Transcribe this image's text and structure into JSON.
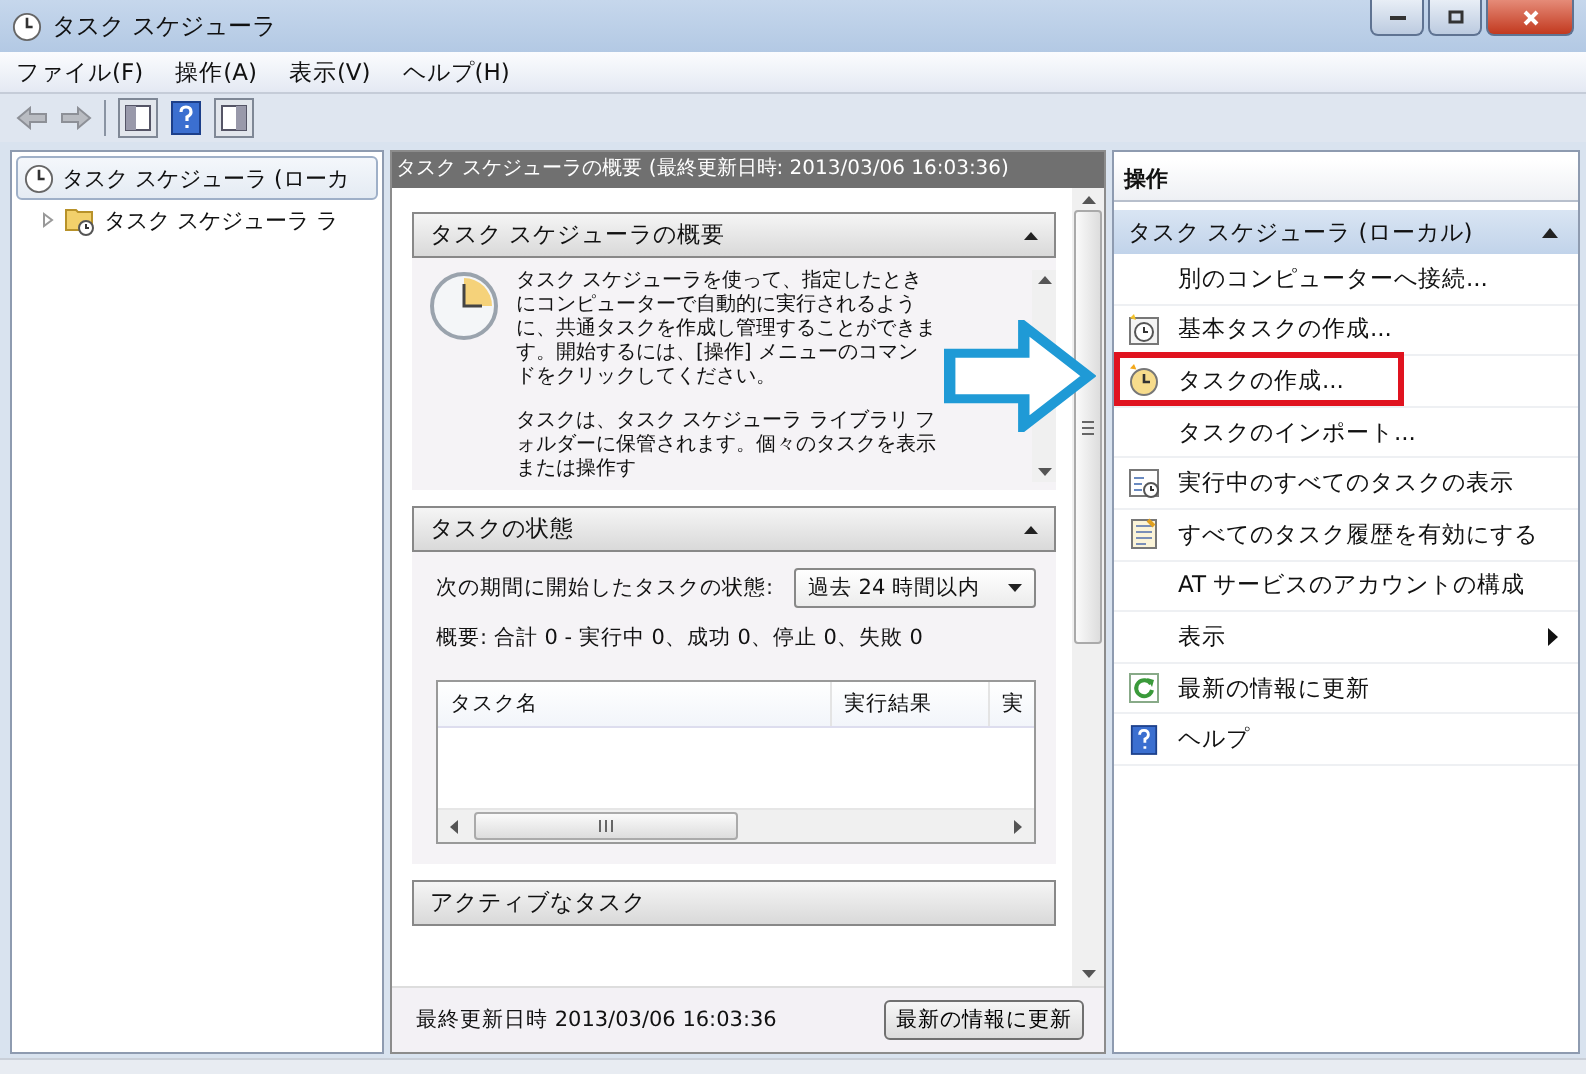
{
  "window": {
    "title": "タスク スケジューラ"
  },
  "menu": [
    "ファイル(F)",
    "操作(A)",
    "表示(V)",
    "ヘルプ(H)"
  ],
  "tree": [
    {
      "label": "タスク スケジューラ (ローカ",
      "selected": true,
      "children": [
        {
          "label": "タスク スケジューラ ラ",
          "selected": false,
          "expanded": false
        }
      ]
    }
  ],
  "center": {
    "title": "タスク スケジューラの概要 (最終更新日時: 2013/03/06 16:03:36)",
    "overview": {
      "title": "タスク スケジューラの概要",
      "paragraphs": [
        "タスク スケジューラを使って、指定したときにコンピューターで自動的に実行されるように、共通タスクを作成し管理することができます。開始するには、[操作] メニューのコマンドをクリックしてください。",
        "タスクは、タスク スケジューラ ライブラリ フォルダーに保管されます。個々のタスクを表示または操作す"
      ]
    },
    "status": {
      "title": "タスクの状態",
      "filter_label": "次の期間に開始したタスクの状態:",
      "filter_value": "過去 24 時間以内",
      "summary": "概要: 合計 0 - 実行中 0、成功 0、停止 0、失敗 0",
      "columns": [
        "タスク名",
        "実行結果",
        "実"
      ]
    },
    "active": {
      "title": "アクティブなタスク"
    },
    "footer": {
      "updated": "最終更新日時 2013/03/06 16:03:36",
      "refresh_button": "最新の情報に更新"
    }
  },
  "actions": {
    "title": "操作",
    "group": "タスク スケジューラ (ローカル)",
    "items": [
      {
        "label": "別のコンピューターへ接続...",
        "kind": "plain",
        "submenu": false,
        "highlighted": false
      },
      {
        "label": "基本タスクの作成...",
        "kind": "basic",
        "submenu": false,
        "highlighted": false
      },
      {
        "label": "タスクの作成...",
        "kind": "create",
        "submenu": false,
        "highlighted": true
      },
      {
        "label": "タスクのインポート...",
        "kind": "plain",
        "submenu": false,
        "highlighted": false
      },
      {
        "label": "実行中のすべてのタスクの表示",
        "kind": "running",
        "submenu": false,
        "highlighted": false
      },
      {
        "label": "すべてのタスク履歴を有効にする",
        "kind": "history",
        "submenu": false,
        "highlighted": false
      },
      {
        "label": "AT サービスのアカウントの構成",
        "kind": "plain",
        "submenu": false,
        "highlighted": false
      },
      {
        "label": "表示",
        "kind": "plain",
        "submenu": true,
        "highlighted": false
      },
      {
        "label": "最新の情報に更新",
        "kind": "refresh",
        "submenu": false,
        "highlighted": false
      },
      {
        "label": "ヘルプ",
        "kind": "help",
        "submenu": false,
        "highlighted": false
      }
    ]
  }
}
